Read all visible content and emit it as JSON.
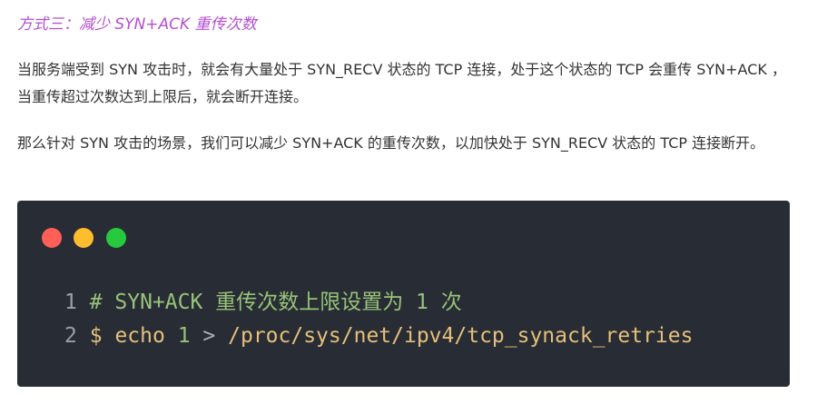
{
  "section": {
    "heading": "方式三：减少 SYN+ACK 重传次数"
  },
  "paragraphs": [
    "当服务端受到 SYN 攻击时，就会有大量处于 SYN_RECV 状态的 TCP 连接，处于这个状态的 TCP 会重传 SYN+ACK ，当重传超过次数达到上限后，就会断开连接。",
    "那么针对 SYN 攻击的场景，我们可以减少 SYN+ACK 的重传次数，以加快处于 SYN_RECV 状态的 TCP 连接断开。"
  ],
  "code": {
    "window_dots": [
      "red",
      "yellow",
      "green"
    ],
    "colors": {
      "background": "#282c34",
      "dot_red": "#ff5f56",
      "dot_yellow": "#ffbd2e",
      "dot_green": "#27c93f",
      "comment": "#98c379",
      "keyword": "#e5c07b"
    },
    "lines": [
      {
        "number": "1",
        "comment": "# SYN+ACK 重传次数上限设置为 1 次"
      },
      {
        "number": "2",
        "prompt": "$",
        "command": "echo",
        "value": "1",
        "operator": ">",
        "path": "/proc/sys/net/ipv4/tcp_synack_retries"
      }
    ]
  }
}
